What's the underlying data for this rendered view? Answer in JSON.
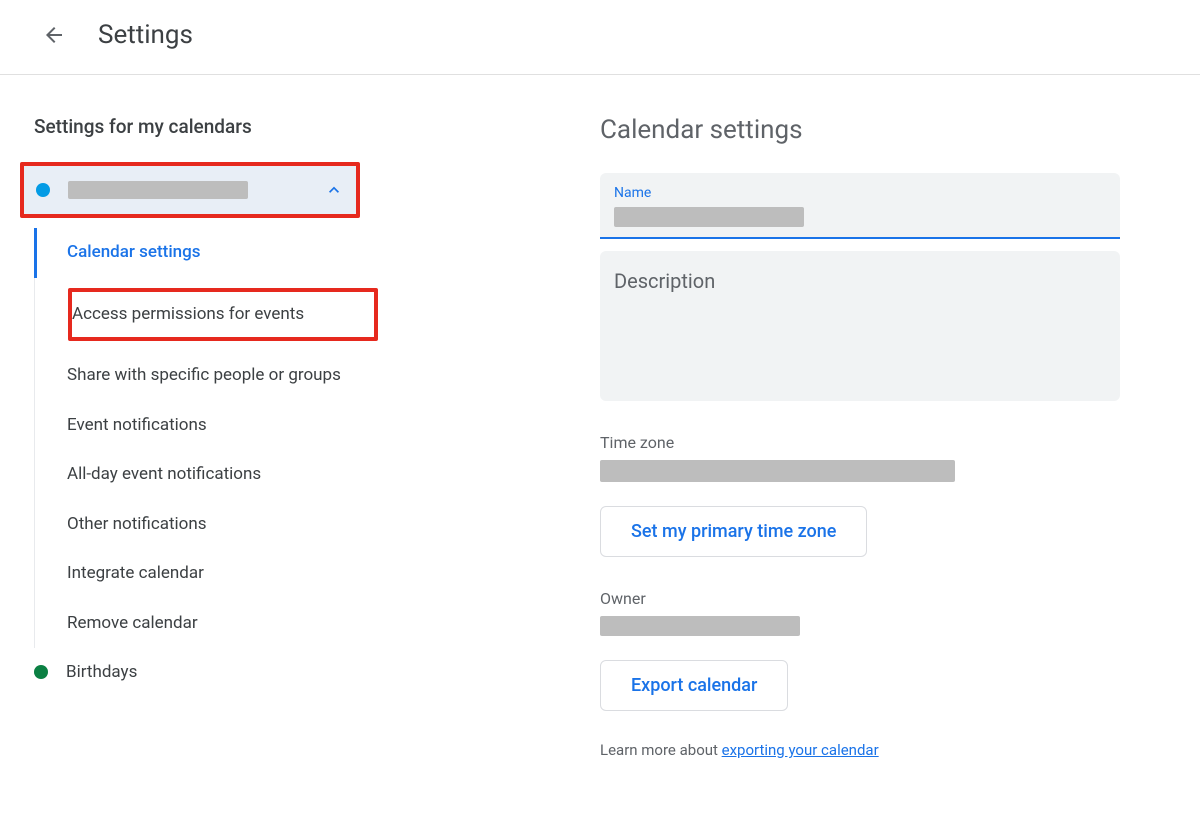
{
  "header": {
    "title": "Settings"
  },
  "sidebar": {
    "heading": "Settings for my calendars",
    "items": [
      {
        "label": "Calendar settings"
      },
      {
        "label": "Access permissions for events"
      },
      {
        "label": "Share with specific people or groups"
      },
      {
        "label": "Event notifications"
      },
      {
        "label": "All-day event notifications"
      },
      {
        "label": "Other notifications"
      },
      {
        "label": "Integrate calendar"
      },
      {
        "label": "Remove calendar"
      }
    ],
    "birthdays": "Birthdays"
  },
  "main": {
    "heading": "Calendar settings",
    "name_label": "Name",
    "description_label": "Description",
    "timezone_label": "Time zone",
    "set_tz_button": "Set my primary time zone",
    "owner_label": "Owner",
    "export_button": "Export calendar",
    "learn_more_prefix": "Learn more about ",
    "learn_more_link": "exporting your calendar"
  }
}
